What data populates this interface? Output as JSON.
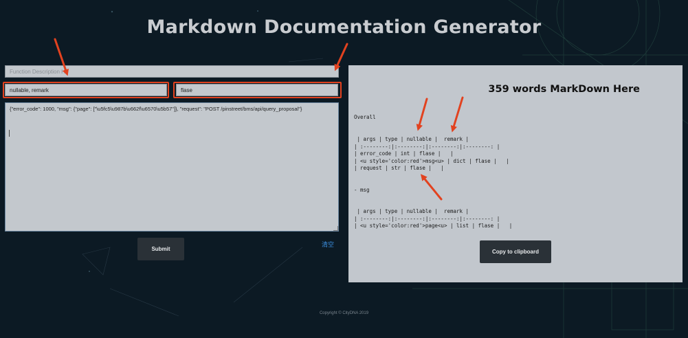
{
  "header": {
    "title": "Markdown Documentation Generator"
  },
  "form": {
    "function_description": {
      "placeholder": "Function Description He"
    },
    "columns_input": {
      "value": "nullable, remark"
    },
    "default_input": {
      "value": "flase"
    },
    "json_input": {
      "value": "{\"error_code\": 1000, \"msg\": {\"page\": [\"\\u5fc5\\u987b\\u662f\\u6570\\u5b57\"]}, \"request\": \"POST /pinstreet/bms/api/query_proposal\"}"
    },
    "submit_label": "Submit",
    "clear_label": "清空"
  },
  "output": {
    "word_count_heading": "359 words MarkDown Here",
    "lines": [
      "Overall",
      " | args | type | nullable |  remark |",
      "| :--------:|:--------:|:--------:|:--------: |",
      "| error_code | int | flase |   |",
      "| <u style='color:red'>msg<u> | dict | flase |   |",
      "| request | str | flase |   |",
      "- msg",
      " | args | type | nullable |  remark |",
      "| :--------:|:--------:|:--------:|:--------: |",
      "| <u style='color:red'>page<u> | list | flase |   |"
    ],
    "copy_label": "Copy to clipboard"
  },
  "footer": {
    "copyright": "Copyright © CityDNA 2019"
  },
  "colors": {
    "background": "#0c1a24",
    "panel": "#c2c7cd",
    "annotation_arrow": "#e2421f",
    "button": "#2a3137",
    "link": "#3b8fe0"
  }
}
